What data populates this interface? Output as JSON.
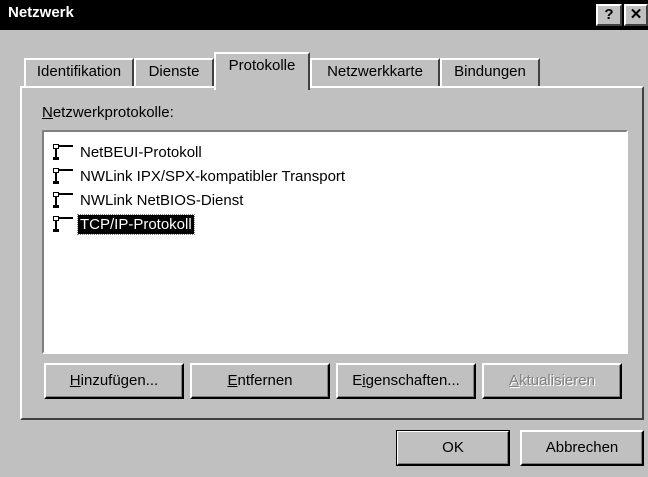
{
  "window": {
    "title": "Netzwerk",
    "help_button": "?",
    "close_button": "✕"
  },
  "tabs": [
    {
      "label": "Identifikation",
      "active": false
    },
    {
      "label": "Dienste",
      "active": false
    },
    {
      "label": "Protokolle",
      "active": true
    },
    {
      "label": "Netzwerkkarte",
      "active": false
    },
    {
      "label": "Bindungen",
      "active": false
    }
  ],
  "protocols": {
    "label": "Netzwerkprotokolle:",
    "items": [
      {
        "label": "NetBEUI-Protokoll",
        "icon": "network-protocol-icon",
        "selected": false
      },
      {
        "label": "NWLink IPX/SPX-kompatibler Transport",
        "icon": "network-protocol-icon",
        "selected": false
      },
      {
        "label": "NWLink NetBIOS-Dienst",
        "icon": "network-protocol-icon",
        "selected": false
      },
      {
        "label": "TCP/IP-Protokoll",
        "icon": "network-protocol-icon",
        "selected": true
      }
    ]
  },
  "buttons": {
    "add": "Hinzufügen...",
    "remove": "Entfernen",
    "properties": "Eigenschaften...",
    "update": "Aktualisieren",
    "update_disabled": true,
    "ok": "OK",
    "cancel": "Abbrechen"
  },
  "colors": {
    "dialog_face": "#c0c0c0",
    "title_bar": "#000000",
    "selection": "#000000"
  }
}
